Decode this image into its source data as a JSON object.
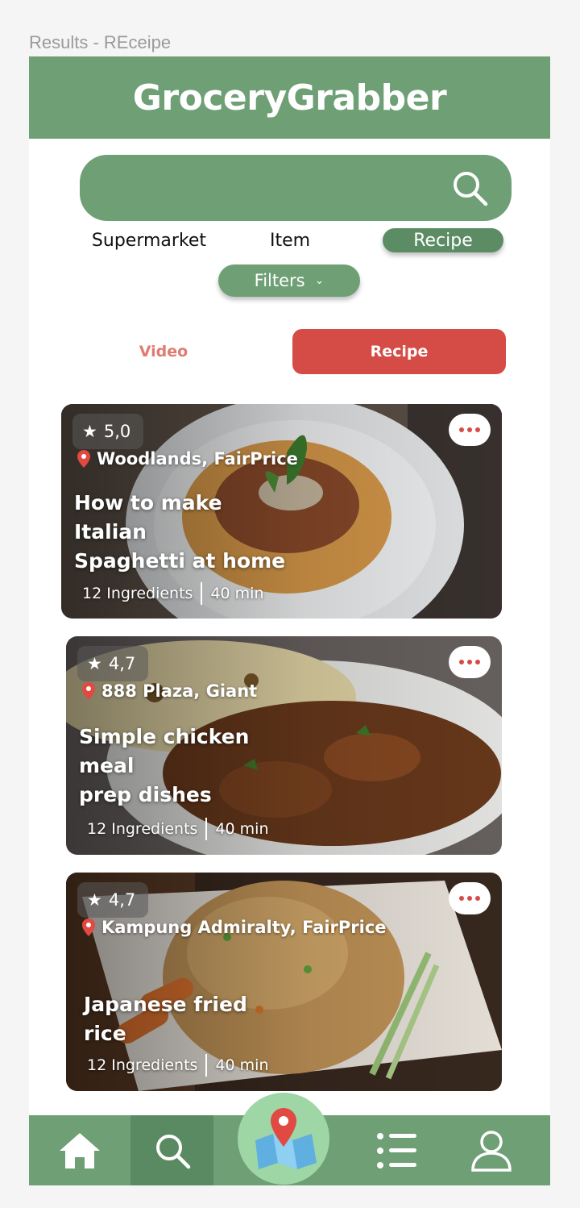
{
  "frame_label": "Results - REceipe",
  "app": {
    "title": "GroceryGrabber"
  },
  "search": {
    "value": "",
    "placeholder": ""
  },
  "category_tabs": [
    {
      "label": "Supermarket",
      "active": false
    },
    {
      "label": "Item",
      "active": false
    },
    {
      "label": "Recipe",
      "active": true
    }
  ],
  "filters": {
    "label": "Filters"
  },
  "content_tabs": {
    "video_label": "Video",
    "recipe_label": "Recipe",
    "active": "Recipe"
  },
  "recipes": [
    {
      "rating": "5,0",
      "location": "Woodlands, FairPrice",
      "title_lines": [
        "How to make",
        "Italian",
        "Spaghetti at home"
      ],
      "ingredients": "12 Ingredients",
      "time": "40 min",
      "image_icon": "spaghetti-image"
    },
    {
      "rating": "4,7",
      "location": "888 Plaza, Giant",
      "title_lines": [
        "Simple chicken",
        "meal",
        "prep dishes"
      ],
      "ingredients": "12 Ingredients",
      "time": "40 min",
      "image_icon": "chicken-curry-image"
    },
    {
      "rating": "4,7",
      "location": "Kampung Admiralty, FairPrice",
      "title_lines": [
        "Japanese fried",
        "rice"
      ],
      "ingredients": "12 Ingredients",
      "time": "40 min",
      "image_icon": "fried-rice-image"
    }
  ],
  "bottom_nav": {
    "items": [
      {
        "icon": "home-icon",
        "active": false
      },
      {
        "icon": "search-icon",
        "active": true
      },
      {
        "icon": "map-icon",
        "active": false
      },
      {
        "icon": "list-icon",
        "active": false
      },
      {
        "icon": "profile-icon",
        "active": false
      }
    ]
  },
  "colors": {
    "primary_green": "#6e9f75",
    "accent_red": "#d54b45",
    "fab_green": "#9ed6a6"
  }
}
